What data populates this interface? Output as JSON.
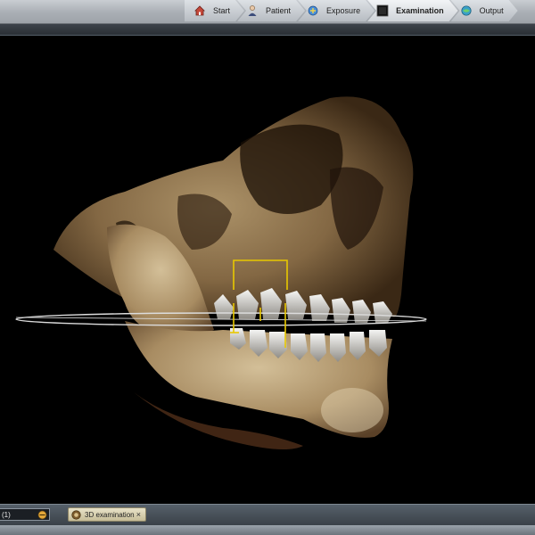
{
  "workflow": {
    "steps": [
      {
        "label": "Start",
        "icon": "home-icon"
      },
      {
        "label": "Patient",
        "icon": "patient-icon"
      },
      {
        "label": "Exposure",
        "icon": "exposure-icon"
      },
      {
        "label": "Examination",
        "icon": "examination-icon",
        "active": true
      },
      {
        "label": "Output",
        "icon": "output-icon"
      }
    ]
  },
  "viewport": {
    "content": "3d-cbct-skull-rendering",
    "accent_color": "#e8c800",
    "plane_color": "#dcdcdc"
  },
  "bottom": {
    "series_value": "(1)",
    "tab_label": "3D examination",
    "tab_icon": "dental-scan-icon",
    "tab_close": "×"
  }
}
